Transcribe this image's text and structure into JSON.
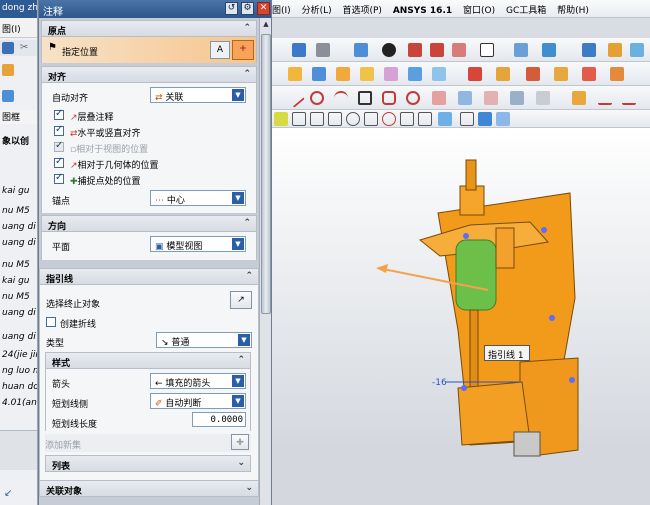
{
  "left_panel": {
    "title_fragment": "dong zh",
    "menu_fragment": "图(I)",
    "section_fragment": "象以创",
    "tab_fragment": "图框",
    "items": [
      "kai gu",
      "nu M5",
      "uang di",
      "uang di",
      "nu M5",
      "kai gu",
      "nu M5",
      "uang di",
      "uang di",
      "24(jie jin",
      "ng luo m",
      "huan do",
      "4.01(an"
    ]
  },
  "dialog": {
    "title": "注释",
    "origin": {
      "header": "原点",
      "specify_location": "指定位置"
    },
    "align": {
      "header": "对齐",
      "auto_align_label": "自动对齐",
      "auto_align_value": "关联",
      "options": [
        {
          "label": "层叠注释",
          "checked": true,
          "enabled": true
        },
        {
          "label": "水平或竖直对齐",
          "checked": true,
          "enabled": true
        },
        {
          "label": "相对于视图的位置",
          "checked": true,
          "enabled": false
        },
        {
          "label": "相对于几何体的位置",
          "checked": true,
          "enabled": true
        },
        {
          "label": "捕捉点处的位置",
          "checked": true,
          "enabled": true
        }
      ],
      "anchor_label": "锚点",
      "anchor_value": "中心"
    },
    "direction": {
      "header": "方向",
      "plane_label": "平面",
      "plane_value": "模型视图"
    },
    "leader": {
      "header": "指引线",
      "select_end_label": "选择终止对象",
      "create_jog_label": "创建折线",
      "type_label": "类型",
      "type_value": "普通",
      "style": {
        "header": "样式",
        "arrow_label": "箭头",
        "arrow_value": "填充的箭头",
        "stub_side_label": "短划线侧",
        "stub_side_value": "自动判断",
        "stub_length_label": "短划线长度",
        "stub_length_value": "0.0000"
      },
      "add_new_set": "添加新集",
      "list_header": "列表"
    },
    "associated_object": "关联对象"
  },
  "app": {
    "menu": [
      "图(I)",
      "分析(L)",
      "首选项(P)",
      "ANSYS 16.1",
      "窗口(O)",
      "GC工具箱",
      "帮助(H)"
    ]
  },
  "canvas": {
    "leader_label": "指引线 1",
    "dim_text": "-16",
    "colors": {
      "model": "#f29b1b",
      "cylinder": "#6cc04a",
      "leader": "#f5a04a"
    }
  }
}
